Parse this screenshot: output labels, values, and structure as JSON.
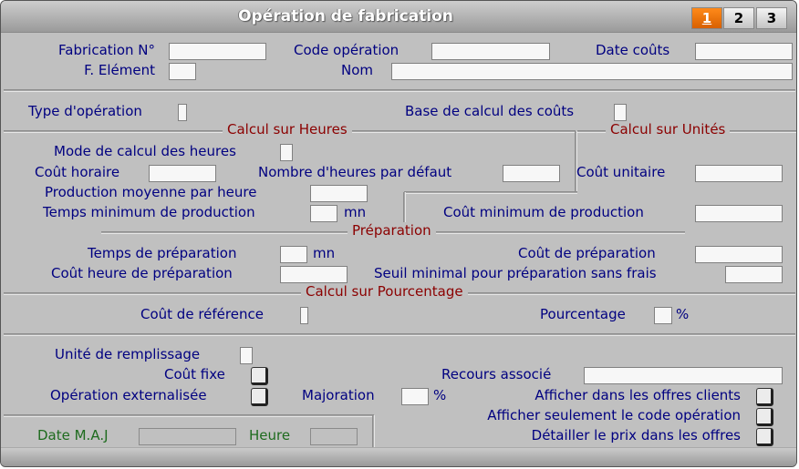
{
  "window": {
    "title": "Opération de fabrication"
  },
  "tabs": [
    {
      "label": "1",
      "active": true
    },
    {
      "label": "2",
      "active": false
    },
    {
      "label": "3",
      "active": false
    }
  ],
  "header": {
    "fabrication_no": {
      "label": "Fabrication N°",
      "value": ""
    },
    "code_operation": {
      "label": "Code opération",
      "value": ""
    },
    "date_couts": {
      "label": "Date coûts",
      "value": ""
    },
    "f_element": {
      "label": "F. Elément",
      "value": ""
    },
    "nom": {
      "label": "Nom",
      "value": ""
    }
  },
  "general": {
    "type_operation": {
      "label": "Type d'opération",
      "value": ""
    },
    "base_calcul": {
      "label": "Base de calcul des coûts",
      "value": ""
    }
  },
  "sections": {
    "heures": "Calcul sur Heures",
    "unites": "Calcul sur Unités",
    "preparation": "Préparation",
    "pourcentage": "Calcul sur Pourcentage"
  },
  "heures": {
    "mode_calcul": {
      "label": "Mode de calcul des heures",
      "value": ""
    },
    "cout_horaire": {
      "label": "Coût horaire",
      "value": ""
    },
    "nb_heures_defaut": {
      "label": "Nombre d'heures par défaut",
      "value": ""
    },
    "production_moyenne": {
      "label": "Production moyenne par heure",
      "value": ""
    },
    "temps_minimum": {
      "label": "Temps minimum de production",
      "value": "",
      "unit": "mn"
    }
  },
  "unites": {
    "cout_unitaire": {
      "label": "Coût unitaire",
      "value": ""
    },
    "cout_minimum": {
      "label": "Coût minimum de production",
      "value": ""
    }
  },
  "preparation": {
    "temps": {
      "label": "Temps de préparation",
      "value": "",
      "unit": "mn"
    },
    "cout": {
      "label": "Coût de préparation",
      "value": ""
    },
    "cout_heure": {
      "label": "Coût heure de préparation",
      "value": ""
    },
    "seuil": {
      "label": "Seuil minimal pour préparation sans frais",
      "value": ""
    }
  },
  "pourcentage": {
    "cout_reference": {
      "label": "Coût de référence",
      "value": ""
    },
    "pourcentage": {
      "label": "Pourcentage",
      "value": "",
      "unit": "%"
    }
  },
  "divers": {
    "unite_remplissage": {
      "label": "Unité de remplissage",
      "value": ""
    },
    "cout_fixe": {
      "label": "Coût fixe",
      "checked": false
    },
    "recours_associe": {
      "label": "Recours associé",
      "value": ""
    },
    "operation_externalisee": {
      "label": "Opération externalisée",
      "checked": false
    },
    "majoration": {
      "label": "Majoration",
      "value": "",
      "unit": "%"
    },
    "afficher_offres": {
      "label": "Afficher dans les offres clients",
      "checked": false
    },
    "afficher_code": {
      "label": "Afficher seulement le code opération",
      "checked": false
    },
    "detailler_prix": {
      "label": "Détailler le prix dans les offres",
      "checked": false
    }
  },
  "footer": {
    "date_maj": {
      "label": "Date M.A.J",
      "value": ""
    },
    "heure": {
      "label": "Heure",
      "value": ""
    }
  }
}
